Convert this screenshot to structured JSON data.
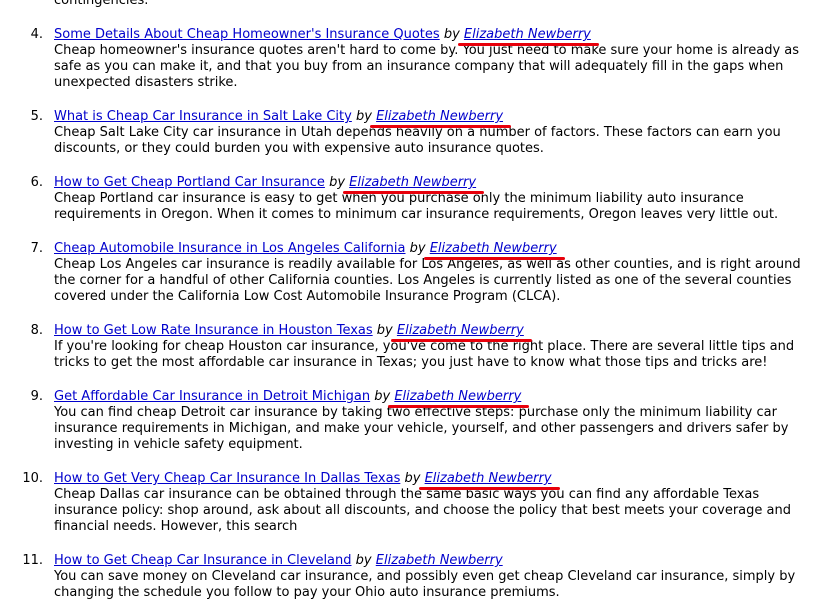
{
  "colors": {
    "link": "#0000cc",
    "annotation": "#e8000b"
  },
  "previous_tail": "contingencies.",
  "items": [
    {
      "num": "4.",
      "title": "Some Details About Cheap Homeowner's Insurance Quotes",
      "by": "by",
      "author": "Elizabeth Newberry",
      "desc": "Cheap homeowner's insurance quotes aren't hard to come by. You just need to make sure your home is already as safe as you can make it, and that you buy from an insurance company that will adequately fill in the gaps when unexpected disasters strike.",
      "annotated": true
    },
    {
      "num": "5.",
      "title": "What is Cheap Car Insurance in Salt Lake City",
      "by": "by",
      "author": "Elizabeth Newberry",
      "desc": "Cheap Salt Lake City car insurance in Utah depends heavily on a number of factors. These factors can earn you discounts, or they could burden you with expensive auto insurance quotes.",
      "annotated": true
    },
    {
      "num": "6.",
      "title": "How to Get Cheap Portland Car Insurance",
      "by": "by",
      "author": "Elizabeth Newberry",
      "desc": "Cheap Portland car insurance is easy to get when you purchase only the minimum liability auto insurance requirements in Oregon. When it comes to minimum car insurance requirements, Oregon leaves very little out.",
      "annotated": true
    },
    {
      "num": "7.",
      "title": "Cheap Automobile Insurance in Los Angeles California",
      "by": "by",
      "author": "Elizabeth Newberry",
      "desc": "Cheap Los Angeles car insurance is readily available for Los Angeles, as well as other counties, and is right around the corner for a handful of other California counties. Los Angeles is currently listed as one of the several counties covered under the California Low Cost Automobile Insurance Program (CLCA).",
      "annotated": true
    },
    {
      "num": "8.",
      "title": "How to Get Low Rate Insurance in Houston Texas",
      "by": "by",
      "author": "Elizabeth Newberry",
      "desc": "If you're looking for cheap Houston car insurance, you've come to the right place. There are several little tips and tricks to get the most affordable car insurance in Texas; you just have to know what those tips and tricks are!",
      "annotated": true
    },
    {
      "num": "9.",
      "title": "Get Affordable Car Insurance in Detroit Michigan",
      "by": "by",
      "author": "Elizabeth Newberry",
      "desc": "You can find cheap Detroit car insurance by taking two effective steps: purchase only the minimum liability car insurance requirements in Michigan, and make your vehicle, yourself, and other passengers and drivers safer by investing in vehicle safety equipment.",
      "annotated": true
    },
    {
      "num": "10.",
      "title": "How to Get Very Cheap Car Insurance In Dallas Texas",
      "by": "by",
      "author": "Elizabeth Newberry",
      "desc": "Cheap Dallas car insurance can be obtained through the same basic ways you can find any affordable Texas insurance policy: shop around, ask about all discounts, and choose the policy that best meets your coverage and financial needs. However, this search",
      "annotated": true
    },
    {
      "num": "11.",
      "title": "How to Get Cheap Car Insurance in Cleveland",
      "by": "by",
      "author": "Elizabeth Newberry",
      "desc": "You can save money on Cleveland car insurance, and possibly even get cheap Cleveland car insurance, simply by changing the schedule you follow to pay your Ohio auto insurance premiums.",
      "annotated": false
    }
  ]
}
